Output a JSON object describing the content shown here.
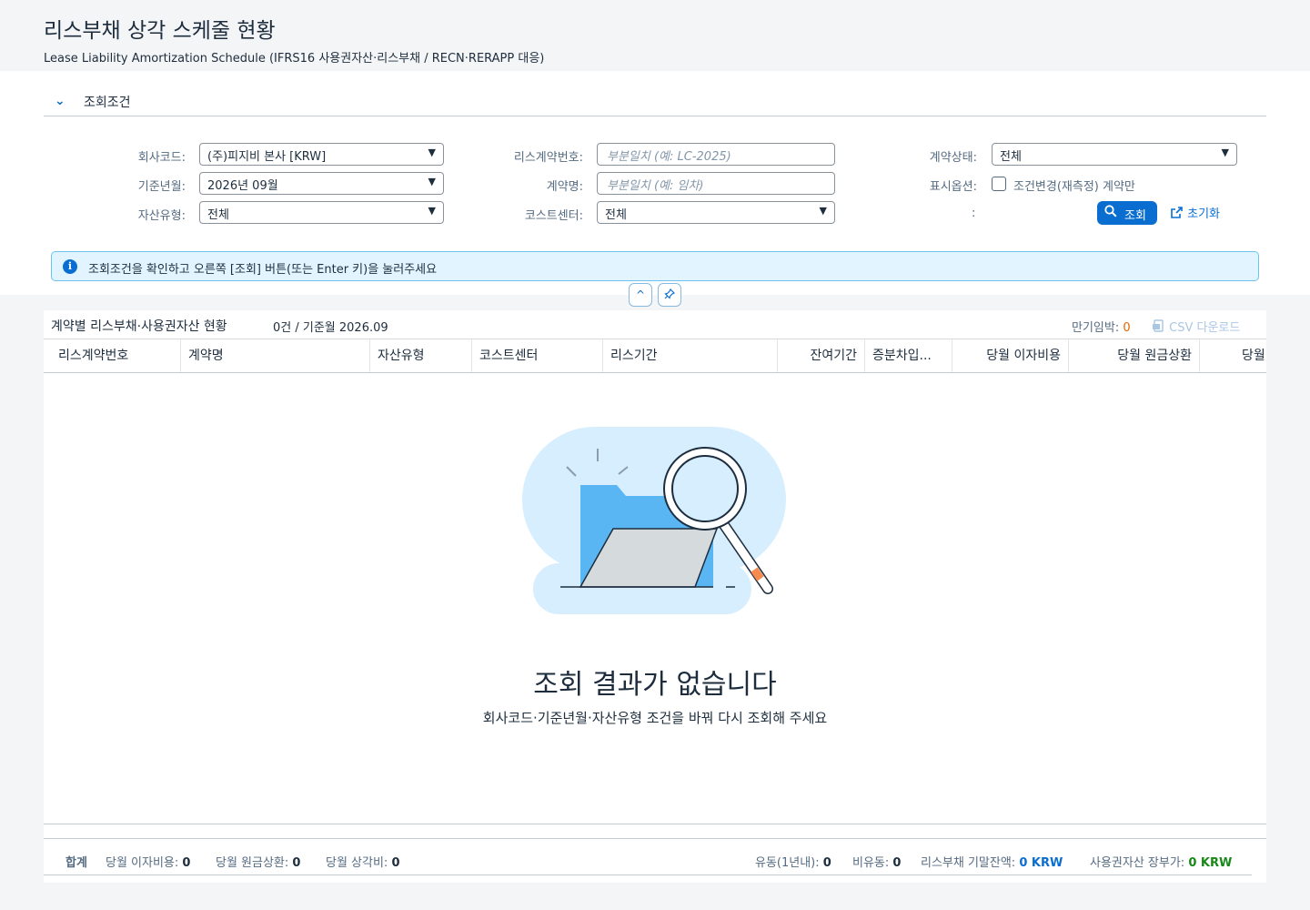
{
  "header": {
    "title": "리스부채 상각 스케줄 현황",
    "subtitle": "Lease Liability Amortization Schedule (IFRS16 사용권자산·리스부채 / RECN·RERAPP 대응)"
  },
  "filter": {
    "section_label": "조회조건",
    "company_label": "회사코드:",
    "company_value": "(주)피지비 본사 [KRW]",
    "period_label": "기준년월:",
    "period_value": "2026년 09월",
    "asset_type_label": "자산유형:",
    "asset_type_value": "전체",
    "contract_no_label": "리스계약번호:",
    "contract_no_placeholder": "부분일치 (예: LC-2025)",
    "contract_name_label": "계약명:",
    "contract_name_placeholder": "부분일치 (예: 임차)",
    "cost_center_label": "코스트센터:",
    "cost_center_value": "전체",
    "status_label": "계약상태:",
    "status_value": "전체",
    "display_option_label": "표시옵션:",
    "display_option_checkbox": "조건변경(재측정) 계약만",
    "empty_label": ":",
    "search_button": "조회",
    "reset_button": "초기화",
    "info_message": "조회조건을 확인하고 오른쪽 [조회] 버튼(또는 Enter 키)을 눌러주세요"
  },
  "table": {
    "title": "계약별 리스부채·사용권자산 현황",
    "count_text": "0건 / 기준월 2026.09",
    "expiring_label": "만기임박:",
    "expiring_value": "0",
    "csv_label": "CSV 다운로드",
    "columns": [
      "리스계약번호",
      "계약명",
      "자산유형",
      "코스트센터",
      "리스기간",
      "잔여기간",
      "증분차입...",
      "당월 이자비용",
      "당월 원금상환",
      "당월"
    ],
    "empty_title": "조회 결과가 없습니다",
    "empty_subtitle": "회사코드·기준년월·자산유형 조건을 바꿔 다시 조회해 주세요"
  },
  "footer": {
    "total_label": "합계",
    "interest_label": "당월 이자비용:",
    "interest_value": "0",
    "principal_label": "당월 원금상환:",
    "principal_value": "0",
    "depreciation_label": "당월 상각비:",
    "depreciation_value": "0",
    "current_label": "유동(1년내):",
    "current_value": "0",
    "noncurrent_label": "비유동:",
    "noncurrent_value": "0",
    "liability_label": "리스부채 기말잔액:",
    "liability_value": "0 KRW",
    "rou_label": "사용권자산 장부가:",
    "rou_value": "0 KRW"
  },
  "colors": {
    "accent": "#0a6ed1",
    "warning": "#e76500",
    "positive": "#188918",
    "info_bg": "#e1f4ff"
  },
  "icons": {
    "collapse": "chevron-down-icon",
    "info": "info-icon",
    "search": "search-icon",
    "reset": "reset-icon",
    "header_collapse": "chevron-up-icon",
    "pin": "pin-icon",
    "csv": "csv-icon",
    "empty": "no-results-illustration"
  }
}
